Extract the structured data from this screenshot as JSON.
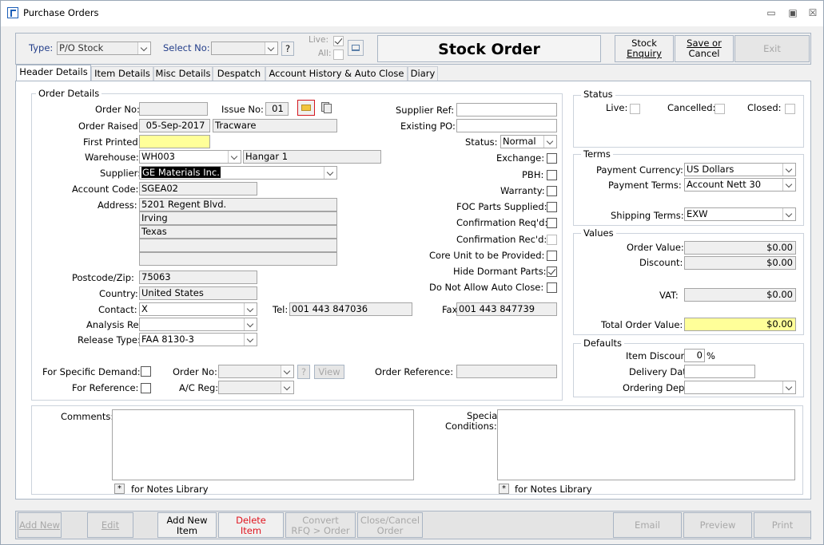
{
  "window": {
    "title": "Purchase Orders",
    "minimize_glyph": "▭",
    "maximize_glyph": "▣",
    "close_glyph": "☒"
  },
  "toolbar": {
    "type_label": "Type:",
    "type_value": "P/O Stock",
    "select_no_label": "Select No:",
    "select_no_value": "",
    "question_label": "?",
    "live_label": "Live:",
    "all_label": "All:",
    "form_title": "Stock Order",
    "stock_enquiry_l1": "Stock",
    "stock_enquiry_l2": "Enquiry",
    "save_cancel_l1": "Save or",
    "save_cancel_l2": "Cancel",
    "exit_label": "Exit"
  },
  "tabs": [
    {
      "label": "Header Details"
    },
    {
      "label": "Item Details"
    },
    {
      "label": "Misc Details"
    },
    {
      "label": "Despatch"
    },
    {
      "label": "Account History & Auto Close"
    },
    {
      "label": "Diary"
    }
  ],
  "order_details": {
    "group_title": "Order Details",
    "order_no_label": "Order No:",
    "order_no": "",
    "issue_no_label": "Issue No:",
    "issue_no": "01",
    "order_raised_label": "Order Raised:",
    "order_raised": "05-Sep-2017",
    "raised_by": "Tracware",
    "first_printed_label": "First Printed:",
    "first_printed": "",
    "warehouse_label": "Warehouse:",
    "warehouse_code": "WH003",
    "warehouse_name": "Hangar 1",
    "supplier_label": "Supplier:",
    "supplier": "GE Materials Inc.",
    "account_code_label": "Account Code:",
    "account_code": "SGEA02",
    "address_label": "Address:",
    "address": [
      "5201 Regent Blvd.",
      "Irving",
      "Texas",
      "",
      ""
    ],
    "postcode_label": "Postcode/Zip:",
    "postcode": "75063",
    "country_label": "Country:",
    "country": "United States",
    "contact_label": "Contact:",
    "contact": "X",
    "tel_label": "Tel:",
    "tel": "001 443 847036",
    "fax_label": "Fax:",
    "fax": "001 443 847739",
    "analysis_ref_label": "Analysis Ref:",
    "analysis_ref": "",
    "release_type_label": "Release Type:",
    "release_type": "FAA 8130-3",
    "supplier_ref_label": "Supplier Ref:",
    "supplier_ref": "",
    "existing_po_label": "Existing PO:",
    "existing_po": "",
    "status_label": "Status:",
    "status": "Normal",
    "exchange_label": "Exchange:",
    "pbh_label": "PBH:",
    "warranty_label": "Warranty:",
    "foc_label": "FOC Parts Supplied:",
    "conf_req_label": "Confirmation Req'd:",
    "conf_rec_label": "Confirmation Rec'd:",
    "core_unit_label": "Core Unit to be Provided:",
    "hide_dormant_label": "Hide Dormant Parts:",
    "no_auto_close_label": "Do Not Allow Auto Close:",
    "specific_demand_label": "For Specific Demand:",
    "for_reference_label": "For Reference:",
    "order_no2_label": "Order No:",
    "ac_reg_label": "A/C Reg:",
    "view_label": "View",
    "order_reference_label": "Order Reference:",
    "order_reference": ""
  },
  "status_group": {
    "title": "Status",
    "live_label": "Live:",
    "cancelled_label": "Cancelled:",
    "closed_label": "Closed:"
  },
  "terms": {
    "title": "Terms",
    "currency_label": "Payment Currency:",
    "currency": "US Dollars",
    "payment_terms_label": "Payment Terms:",
    "payment_terms": "Account Nett 30",
    "shipping_terms_label": "Shipping Terms:",
    "shipping_terms": "EXW"
  },
  "values": {
    "title": "Values",
    "order_value_label": "Order Value:",
    "order_value": "$0.00",
    "discount_label": "Discount:",
    "discount": "$0.00",
    "vat_label": "VAT:",
    "vat": "$0.00",
    "total_label": "Total Order Value:",
    "total": "$0.00"
  },
  "defaults": {
    "title": "Defaults",
    "item_discount_label": "Item Discount:",
    "item_discount": "0",
    "percent": "%",
    "delivery_date_label": "Delivery Date:",
    "delivery_date": "",
    "ordering_dept_label": "Ordering Dept:",
    "ordering_dept": ""
  },
  "notes": {
    "comments_label": "Comments:",
    "special_l1": "Special",
    "special_l2": "Conditions:",
    "star": "*",
    "notes_library": "for Notes Library"
  },
  "bottom": {
    "add_new": "Add New",
    "edit": "Edit",
    "add_item_l1": "Add New",
    "add_item_l2": "Item",
    "delete_l1": "Delete",
    "delete_l2": "Item",
    "convert_l1": "Convert",
    "convert_l2": "RFQ > Order",
    "close_l1": "Close/Cancel",
    "close_l2": "Order",
    "email": "Email",
    "preview": "Preview",
    "print": "Print"
  },
  "colors": {
    "accent_blue": "#233e8a",
    "highlight_yellow": "#ffff99",
    "delete_red": "#e0141e",
    "icon_border_red": "#d4161e"
  }
}
